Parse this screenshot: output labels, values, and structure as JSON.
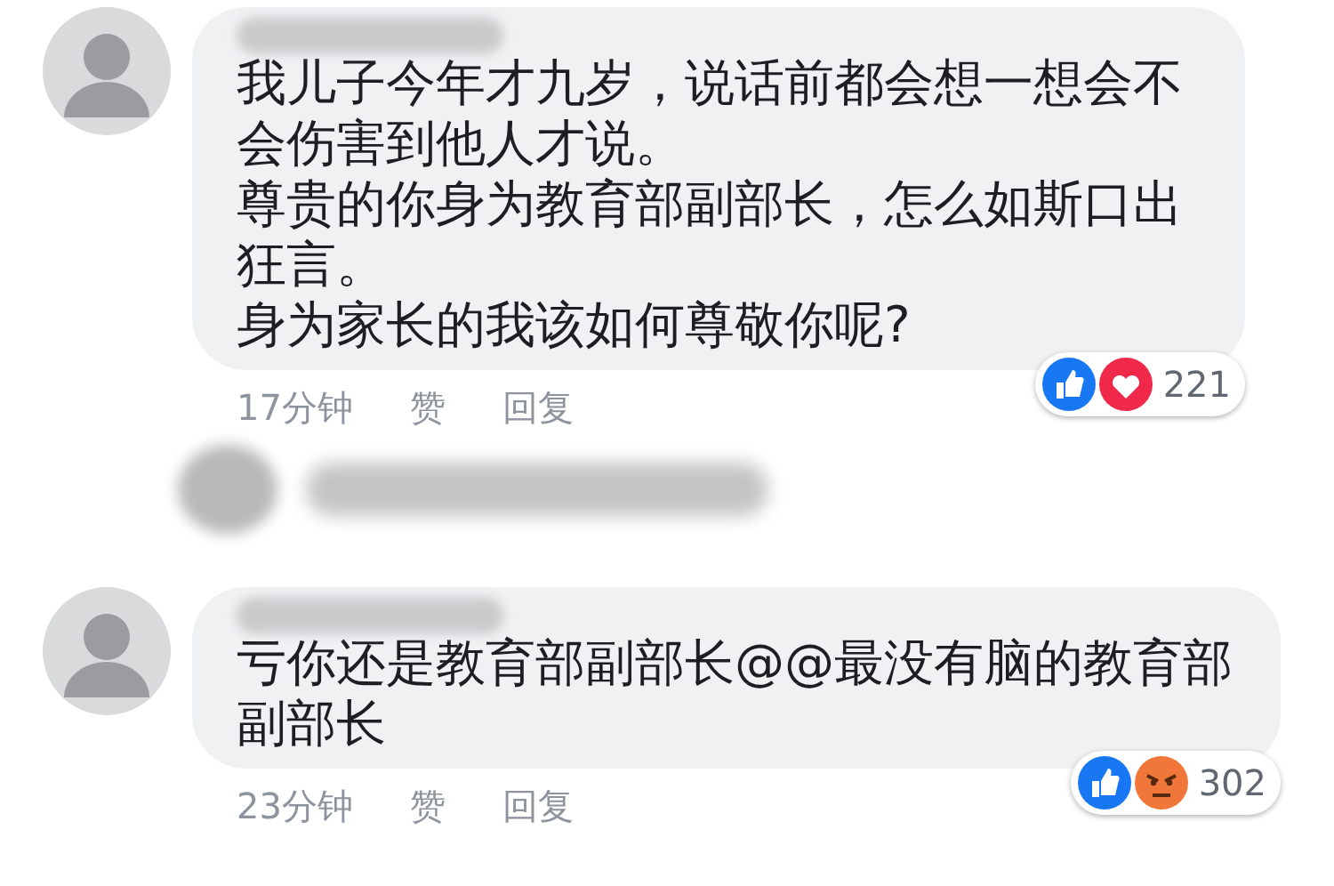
{
  "comments": [
    {
      "paragraphs": [
        "我儿子今年才九岁，说话前都会想一想会不会伤害到他人才说。",
        "尊贵的你身为教育部副部长，怎么如斯口出狂言。",
        "身为家长的我该如何尊敬你呢?"
      ],
      "time": "17分钟",
      "like": "赞",
      "reply": "回复",
      "reactions": [
        {
          "kind": "like"
        },
        {
          "kind": "love"
        }
      ],
      "reaction_count": "221"
    },
    {
      "paragraphs": [
        "亏你还是教育部副部长@@最没有脑的教育部副部长"
      ],
      "time": "23分钟",
      "like": "赞",
      "reply": "回复",
      "reactions": [
        {
          "kind": "like"
        },
        {
          "kind": "angry"
        }
      ],
      "reaction_count": "302"
    }
  ]
}
